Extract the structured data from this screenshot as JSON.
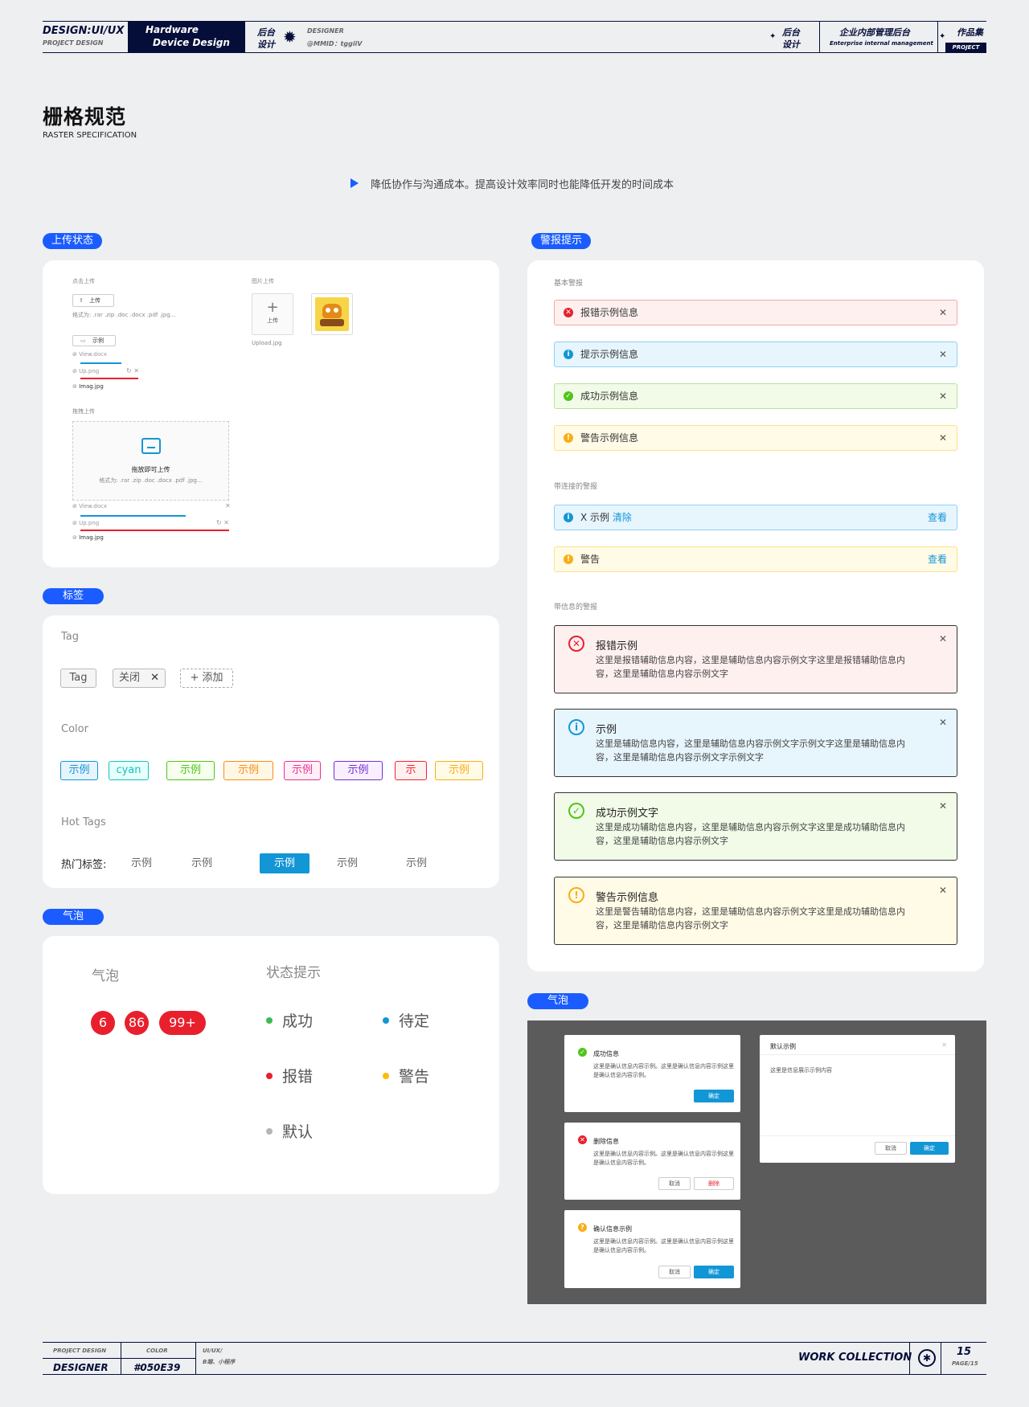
{
  "header": {
    "design_label": "DESIGN:UI/UX",
    "project_design_small": "PROJECT DESIGN",
    "hardware_line1": "Hardware",
    "hardware_line2": "Device Design",
    "backend_line1": "后台",
    "backend_line2": "设计",
    "designer_label": "DESIGNER",
    "designer_handle": "@MMID：tggiiV",
    "right_backend_line1": "后台",
    "right_backend_line2": "设计",
    "company_title": "企业内部管理后台",
    "company_subtitle": "Enterprise internal management",
    "collection_label": "作品集",
    "project_badge": "PROJECT"
  },
  "page": {
    "title": "栅格规范",
    "subtitle": "RASTER SPECIFICATION",
    "intro": "降低协作与沟通成本。提高设计效率同时也能降低开发的时间成本"
  },
  "upload": {
    "section_label": "上传状态",
    "click_upload_label": "点击上传",
    "upload_button": "上传",
    "format_hint": "格式为: .rar .zip .doc .docx .pdf .jpg...",
    "example_button": "示例",
    "files": [
      "View.docx",
      "Up.png",
      "Imag.jpg"
    ],
    "image_upload_label": "图片上传",
    "image_upload_button": "上传",
    "image_filename": "Upload.jpg",
    "drag_upload_label": "拖拽上传",
    "drag_title": "拖放即可上传",
    "drag_format_hint": "格式为: .rar .zip .doc .docx .pdf .jpg...",
    "drag_files": [
      "View.docx",
      "Up.png",
      "Imag.jpg"
    ]
  },
  "tags": {
    "section_label": "标签",
    "tag_heading": "Tag",
    "basic_tag": "Tag",
    "close_tag": "关闭",
    "add_tag": "添加",
    "color_heading": "Color",
    "color_tags": [
      {
        "label": "示例",
        "color": "#1396d6",
        "bg": "#e6f4fc"
      },
      {
        "label": "cyan",
        "color": "#13c2c2",
        "bg": "#e6fffb"
      },
      {
        "label": "示例",
        "color": "#52c41a",
        "bg": "#f6ffed"
      },
      {
        "label": "示例",
        "color": "#fa8c16",
        "bg": "#fff7e6"
      },
      {
        "label": "示例",
        "color": "#eb2f96",
        "bg": "#fff0f6"
      },
      {
        "label": "示例",
        "color": "#722ed1",
        "bg": "#f9f0ff"
      },
      {
        "label": "示",
        "color": "#f5222d",
        "bg": "#fff1f0"
      },
      {
        "label": "示例",
        "color": "#faad14",
        "bg": "#fffbe6"
      }
    ],
    "hot_heading": "Hot Tags",
    "hot_label": "热门标签:",
    "hot_tags": [
      "示例",
      "示例",
      "示例",
      "示例",
      "示例"
    ],
    "hot_selected_index": 2
  },
  "bubble": {
    "section_label": "气泡",
    "bubble_heading": "气泡",
    "badges": [
      "6",
      "86",
      "99+"
    ],
    "status_heading": "状态提示",
    "statuses": [
      {
        "label": "成功",
        "color": "#3dbb54"
      },
      {
        "label": "待定",
        "color": "#1396d6"
      },
      {
        "label": "报错",
        "color": "#e8202d"
      },
      {
        "label": "警告",
        "color": "#fbbb0d"
      },
      {
        "label": "默认",
        "color": "#b5b5b5"
      }
    ]
  },
  "alerts": {
    "section_label": "警报提示",
    "basic_label": "基本警报",
    "basic": [
      "报错示例信息",
      "提示示例信息",
      "成功示例信息",
      "警告示例信息"
    ],
    "link_label": "带连接的警报",
    "link_info_prefix": "X 示例",
    "link_info_clear": "清除",
    "link_warn": "警告",
    "view_link": "查看",
    "desc_label": "带信息的警报",
    "desc": [
      {
        "title": "报错示例",
        "body": "这里是报错辅助信息内容，这里是辅助信息内容示例文字这里是报错辅助信息内容，这里是辅助信息内容示例文字"
      },
      {
        "title": "示例",
        "body": "这里是辅助信息内容，这里是辅助信息内容示例文字示例文字这里是辅助信息内容，这里是辅助信息内容示例文字示例文字"
      },
      {
        "title": "成功示例文字",
        "body": "这里是成功辅助信息内容，这里是辅助信息内容示例文字这里是成功辅助信息内容，这里是辅助信息内容示例文字"
      },
      {
        "title": "警告示例信息",
        "body": "这里是警告辅助信息内容，这里是辅助信息内容示例文字这里是成功辅助信息内容，这里是辅助信息内容示例文字"
      }
    ]
  },
  "dialogs": {
    "section_label": "气泡",
    "success_title": "成功信息",
    "delete_title": "删除信息",
    "confirm_title": "确认信息示例",
    "confirm_body": "这里是确认信息内容示例。这里是确认信息内容示例这里是确认信息内容示例。",
    "default_title": "默认示例",
    "default_body": "这里是信息展示示例内容",
    "ok_button": "确定",
    "cancel_button": "取消",
    "delete_button": "删除"
  },
  "footer": {
    "project_design_small": "PROJECT DESIGN",
    "designer_label": "DESIGNER",
    "color_small": "COLOR",
    "color_value": "#050E39",
    "uiux_small": "UI/UX/",
    "platform_small": "B端、小程序",
    "work_collection": "WORK COLLECTION",
    "page_number": "15",
    "page_small": "PAGE/15"
  },
  "colors": {
    "navy": "#050E39",
    "accent_blue": "#1a5cff",
    "primary": "#1396d6"
  }
}
